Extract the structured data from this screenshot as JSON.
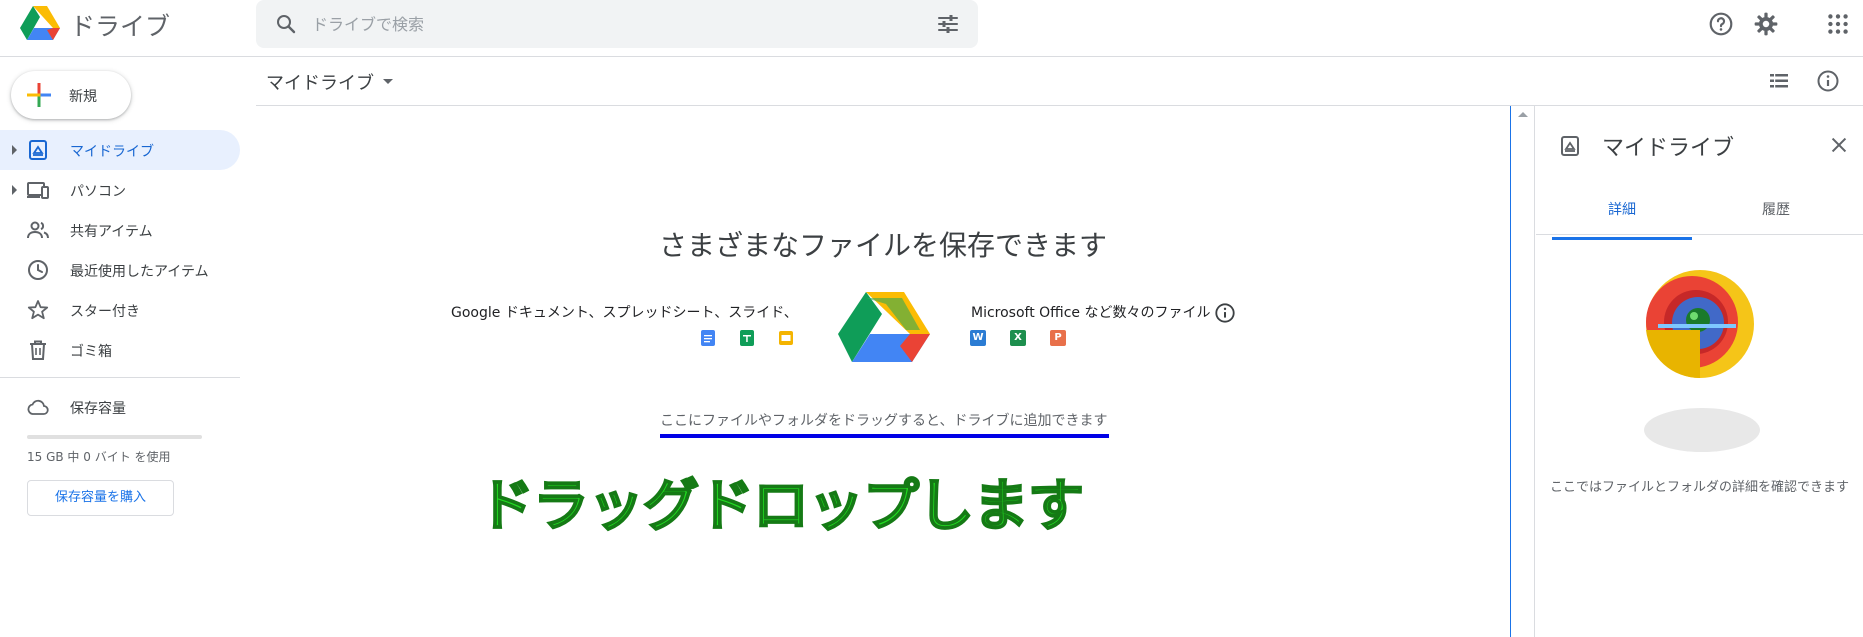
{
  "app": {
    "name": "ドライブ",
    "search_placeholder": "ドライブで検索"
  },
  "sidebar": {
    "new_label": "新規",
    "items": [
      {
        "label": "マイドライブ",
        "icon": "my-drive-icon",
        "active": true,
        "expandable": true
      },
      {
        "label": "パソコン",
        "icon": "computer-icon",
        "active": false,
        "expandable": true
      },
      {
        "label": "共有アイテム",
        "icon": "people-icon",
        "active": false,
        "expandable": false
      },
      {
        "label": "最近使用したアイテム",
        "icon": "clock-icon",
        "active": false,
        "expandable": false
      },
      {
        "label": "スター付き",
        "icon": "star-icon",
        "active": false,
        "expandable": false
      },
      {
        "label": "ゴミ箱",
        "icon": "trash-icon",
        "active": false,
        "expandable": false
      }
    ],
    "storage_label": "保存容量",
    "storage_usage": "15 GB 中 0 バイト を使用",
    "storage_used_fraction": 0,
    "buy_storage_label": "保存容量を購入"
  },
  "main": {
    "breadcrumb": "マイドライブ",
    "empty_title": "さまざまなファイルを保存できます",
    "left_caption": "Google ドキュメント、スプレッドシート、スライド、",
    "right_caption": "Microsoft Office など数々のファイル",
    "drop_hint": "ここにファイルやフォルダをドラッグすると、ドライブに追加できます",
    "annotation": "ドラッグドロップします",
    "office_icons": [
      "W",
      "X",
      "P"
    ]
  },
  "details": {
    "title": "マイドライブ",
    "tabs": [
      "詳細",
      "履歴"
    ],
    "active_tab": "詳細",
    "message": "ここではファイルとフォルダの詳細を確認できます"
  },
  "colors": {
    "accent": "#1a73e8",
    "active_bg": "#e8f0fe",
    "annotation_green": "#22dd22",
    "underline_blue": "#0000e6",
    "docs_blue": "#4285f4",
    "sheets_green": "#0f9d58",
    "slides_yellow": "#f4b400",
    "word_blue": "#2b7cd3",
    "excel_green": "#1d8f4e",
    "ppt_orange": "#e8704a"
  }
}
